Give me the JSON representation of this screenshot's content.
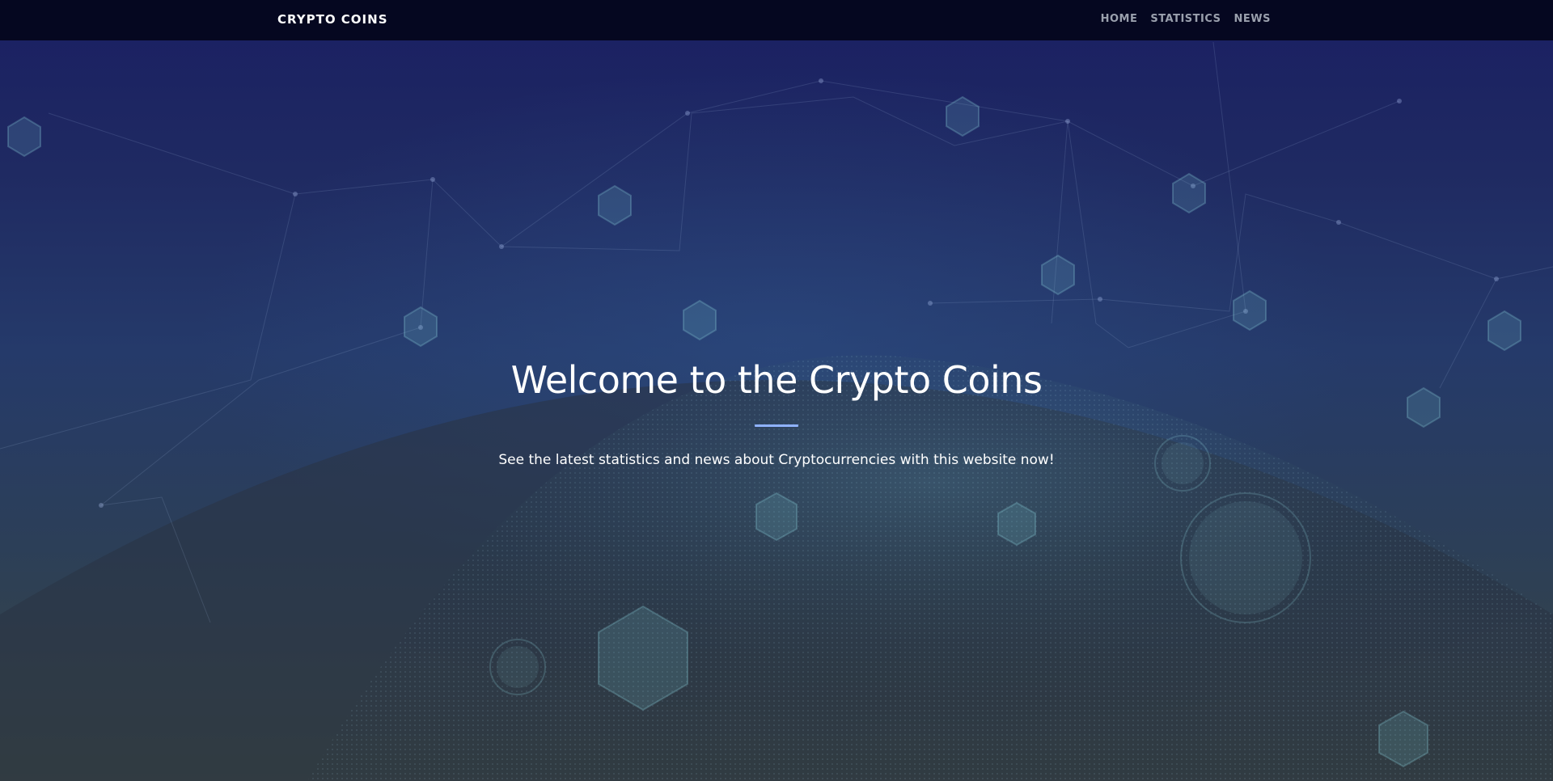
{
  "brand": "CRYPTO COINS",
  "nav": {
    "items": [
      {
        "label": "HOME"
      },
      {
        "label": "STATISTICS"
      },
      {
        "label": "NEWS"
      }
    ]
  },
  "hero": {
    "title": "Welcome to the Crypto Coins",
    "subtitle": "See the latest statistics and news about Cryptocurrencies with this website now!",
    "divider_color": "#8fb2ff"
  },
  "colors": {
    "navbar_background": "#050720",
    "nav_link": "#9aa0ad",
    "hero_top": "#1a1f63",
    "hero_bottom": "#3a4640"
  }
}
